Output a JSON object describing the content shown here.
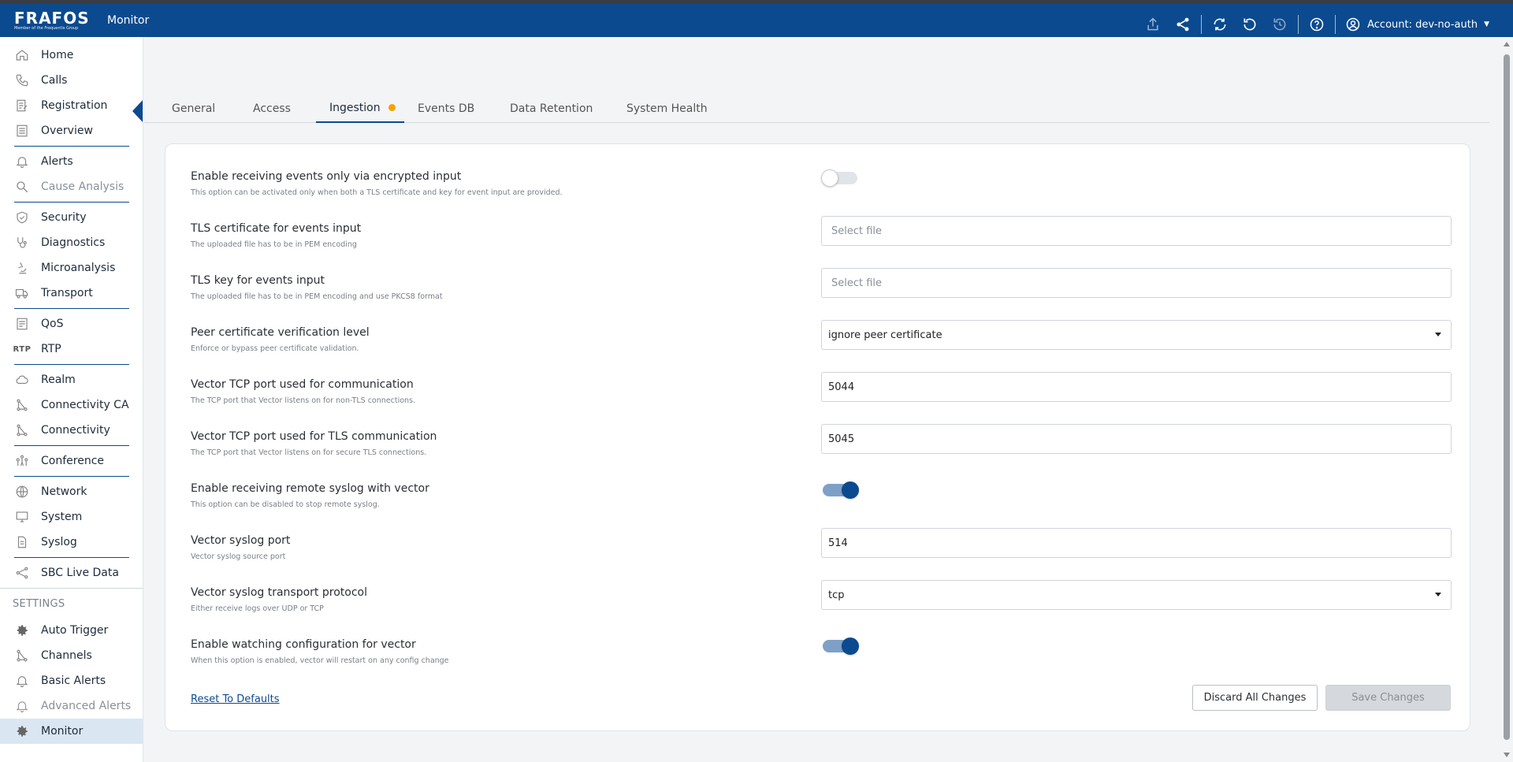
{
  "header": {
    "logo_text": "FRAFOS",
    "logo_subtext": "Member of the Frequentis Group",
    "app_title": "Monitor",
    "account_label": "Account: dev-no-auth",
    "icons": [
      "export-icon",
      "share-icon",
      "sync-icon",
      "refresh-icon",
      "history-icon",
      "help-icon",
      "user-circle-icon"
    ]
  },
  "sidebar": {
    "items": [
      {
        "label": "Home",
        "icon": "home-icon"
      },
      {
        "label": "Calls",
        "icon": "phone-icon"
      },
      {
        "label": "Registration",
        "icon": "registration-icon"
      },
      {
        "label": "Overview",
        "icon": "overview-icon"
      },
      {
        "label": "Alerts",
        "icon": "bell-icon"
      },
      {
        "label": "Cause Analysis",
        "icon": "search-icon"
      },
      {
        "label": "Security",
        "icon": "shield-icon"
      },
      {
        "label": "Diagnostics",
        "icon": "stethoscope-icon"
      },
      {
        "label": "Microanalysis",
        "icon": "microscope-icon"
      },
      {
        "label": "Transport",
        "icon": "truck-icon"
      },
      {
        "label": "QoS",
        "icon": "qos-icon"
      },
      {
        "label": "RTP",
        "icon": "rtp-icon"
      },
      {
        "label": "Realm",
        "icon": "cloud-icon"
      },
      {
        "label": "Connectivity CA",
        "icon": "connectivity-icon"
      },
      {
        "label": "Connectivity",
        "icon": "connectivity-icon"
      },
      {
        "label": "Conference",
        "icon": "people-icon"
      },
      {
        "label": "Network",
        "icon": "globe-icon"
      },
      {
        "label": "System",
        "icon": "monitor-icon"
      },
      {
        "label": "Syslog",
        "icon": "document-icon"
      },
      {
        "label": "SBC Live Data",
        "icon": "nodes-icon"
      }
    ],
    "settings_label": "SETTINGS",
    "settings_items": [
      {
        "label": "Auto Trigger",
        "icon": "gear-icon"
      },
      {
        "label": "Channels",
        "icon": "channels-icon"
      },
      {
        "label": "Basic Alerts",
        "icon": "bell-icon"
      },
      {
        "label": "Advanced Alerts",
        "icon": "bell-plus-icon"
      },
      {
        "label": "Monitor",
        "icon": "gear-icon"
      }
    ]
  },
  "tabs": [
    "General",
    "Access",
    "Ingestion",
    "Events DB",
    "Data Retention",
    "System Health"
  ],
  "active_tab": "Ingestion",
  "settings": [
    {
      "label": "Enable receiving events only via encrypted input",
      "hint": "This option can be activated only when both a TLS certificate and key for event input are provided.",
      "type": "toggle",
      "value": false
    },
    {
      "label": "TLS certificate for events input",
      "hint": "The uploaded file has to be in PEM encoding",
      "type": "file",
      "placeholder": "Select file"
    },
    {
      "label": "TLS key for events input",
      "hint": "The uploaded file has to be in PEM encoding and use PKCS8 format",
      "type": "file",
      "placeholder": "Select file"
    },
    {
      "label": "Peer certificate verification level",
      "hint": "Enforce or bypass peer certificate validation.",
      "type": "select",
      "value": "ignore peer certificate"
    },
    {
      "label": "Vector TCP port used for communication",
      "hint": "The TCP port that Vector listens on for non-TLS connections.",
      "type": "text",
      "value": "5044"
    },
    {
      "label": "Vector TCP port used for TLS communication",
      "hint": "The TCP port that Vector listens on for secure TLS connections.",
      "type": "text",
      "value": "5045"
    },
    {
      "label": "Enable receiving remote syslog with vector",
      "hint": "This option can be disabled to stop remote syslog.",
      "type": "toggle",
      "value": true
    },
    {
      "label": "Vector syslog port",
      "hint": "Vector syslog source port",
      "type": "text",
      "value": "514"
    },
    {
      "label": "Vector syslog transport protocol",
      "hint": "Either receive logs over UDP or TCP",
      "type": "select",
      "value": "tcp"
    },
    {
      "label": "Enable watching configuration for vector",
      "hint": "When this option is enabled, vector will restart on any config change",
      "type": "toggle",
      "value": true
    }
  ],
  "actions": {
    "reset_label": "Reset To Defaults",
    "discard_label": "Discard All Changes",
    "save_label": "Save Changes"
  },
  "colors": {
    "brand": "#0b4a8f",
    "modified_dot": "#f5a300"
  }
}
